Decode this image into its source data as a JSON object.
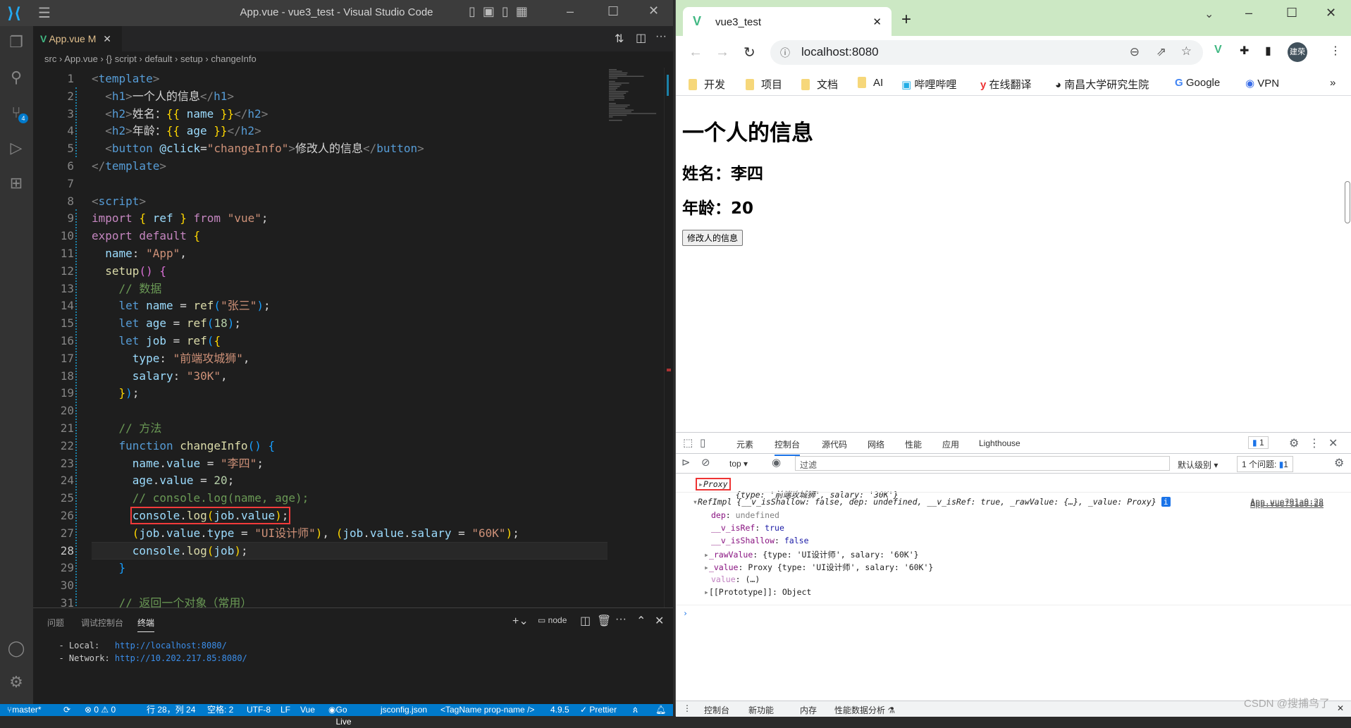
{
  "vscode": {
    "title": "App.vue - vue3_test - Visual Studio Code",
    "tab": {
      "label": "App.vue",
      "modified": "M"
    },
    "breadcrumb": [
      "src",
      "App.vue",
      "{} script",
      "default",
      "setup",
      "changeInfo"
    ],
    "source_control_badge": "4",
    "current_line": 28,
    "code": [
      [
        [
          "p",
          "<"
        ],
        [
          "tag",
          "template"
        ],
        [
          "p",
          ">"
        ]
      ],
      [
        [
          "t",
          "  "
        ],
        [
          "p",
          "<"
        ],
        [
          "tag",
          "h1"
        ],
        [
          "p",
          ">"
        ],
        [
          "t",
          "一个人的信息"
        ],
        [
          "p",
          "</"
        ],
        [
          "tag",
          "h1"
        ],
        [
          "p",
          ">"
        ]
      ],
      [
        [
          "t",
          "  "
        ],
        [
          "p",
          "<"
        ],
        [
          "tag",
          "h2"
        ],
        [
          "p",
          ">"
        ],
        [
          "t",
          "姓名："
        ],
        [
          "br1",
          "{{"
        ],
        [
          "var",
          " name "
        ],
        [
          "br1",
          "}}"
        ],
        [
          "p",
          "</"
        ],
        [
          "tag",
          "h2"
        ],
        [
          "p",
          ">"
        ]
      ],
      [
        [
          "t",
          "  "
        ],
        [
          "p",
          "<"
        ],
        [
          "tag",
          "h2"
        ],
        [
          "p",
          ">"
        ],
        [
          "t",
          "年龄："
        ],
        [
          "br1",
          "{{"
        ],
        [
          "var",
          " age "
        ],
        [
          "br1",
          "}}"
        ],
        [
          "p",
          "</"
        ],
        [
          "tag",
          "h2"
        ],
        [
          "p",
          ">"
        ]
      ],
      [
        [
          "t",
          "  "
        ],
        [
          "p",
          "<"
        ],
        [
          "tag",
          "button"
        ],
        [
          "t",
          " "
        ],
        [
          "var",
          "@click"
        ],
        [
          "t",
          "="
        ],
        [
          "str",
          "\"changeInfo\""
        ],
        [
          "p",
          ">"
        ],
        [
          "t",
          "修改人的信息"
        ],
        [
          "p",
          "</"
        ],
        [
          "tag",
          "button"
        ],
        [
          "p",
          ">"
        ]
      ],
      [
        [
          "p",
          "</"
        ],
        [
          "tag",
          "template"
        ],
        [
          "p",
          ">"
        ]
      ],
      [],
      [
        [
          "p",
          "<"
        ],
        [
          "tag",
          "script"
        ],
        [
          "p",
          ">"
        ]
      ],
      [
        [
          "kw",
          "import"
        ],
        [
          "t",
          " "
        ],
        [
          "br1",
          "{"
        ],
        [
          "var",
          " ref "
        ],
        [
          "br1",
          "}"
        ],
        [
          "t",
          " "
        ],
        [
          "kw",
          "from"
        ],
        [
          "t",
          " "
        ],
        [
          "str",
          "\"vue\""
        ],
        [
          "t",
          ";"
        ]
      ],
      [
        [
          "kw",
          "export default"
        ],
        [
          "t",
          " "
        ],
        [
          "br1",
          "{"
        ]
      ],
      [
        [
          "t",
          "  "
        ],
        [
          "var",
          "name"
        ],
        [
          "t",
          ": "
        ],
        [
          "str",
          "\"App\""
        ],
        [
          "t",
          ","
        ]
      ],
      [
        [
          "t",
          "  "
        ],
        [
          "fn",
          "setup"
        ],
        [
          "br2",
          "()"
        ],
        [
          "t",
          " "
        ],
        [
          "br2",
          "{"
        ]
      ],
      [
        [
          "t",
          "    "
        ],
        [
          "cm",
          "// 数据"
        ]
      ],
      [
        [
          "t",
          "    "
        ],
        [
          "kw2",
          "let"
        ],
        [
          "t",
          " "
        ],
        [
          "var",
          "name"
        ],
        [
          "t",
          " = "
        ],
        [
          "fn",
          "ref"
        ],
        [
          "br3",
          "("
        ],
        [
          "str",
          "\"张三\""
        ],
        [
          "br3",
          ")"
        ],
        [
          "t",
          ";"
        ]
      ],
      [
        [
          "t",
          "    "
        ],
        [
          "kw2",
          "let"
        ],
        [
          "t",
          " "
        ],
        [
          "var",
          "age"
        ],
        [
          "t",
          " = "
        ],
        [
          "fn",
          "ref"
        ],
        [
          "br3",
          "("
        ],
        [
          "num",
          "18"
        ],
        [
          "br3",
          ")"
        ],
        [
          "t",
          ";"
        ]
      ],
      [
        [
          "t",
          "    "
        ],
        [
          "kw2",
          "let"
        ],
        [
          "t",
          " "
        ],
        [
          "var",
          "job"
        ],
        [
          "t",
          " = "
        ],
        [
          "fn",
          "ref"
        ],
        [
          "br3",
          "("
        ],
        [
          "br1",
          "{"
        ]
      ],
      [
        [
          "t",
          "      "
        ],
        [
          "var",
          "type"
        ],
        [
          "t",
          ": "
        ],
        [
          "str",
          "\"前端攻城狮\""
        ],
        [
          "t",
          ","
        ]
      ],
      [
        [
          "t",
          "      "
        ],
        [
          "var",
          "salary"
        ],
        [
          "t",
          ": "
        ],
        [
          "str",
          "\"30K\""
        ],
        [
          "t",
          ","
        ]
      ],
      [
        [
          "t",
          "    "
        ],
        [
          "br1",
          "}"
        ],
        [
          "br3",
          ")"
        ],
        [
          "t",
          ";"
        ]
      ],
      [],
      [
        [
          "t",
          "    "
        ],
        [
          "cm",
          "// 方法"
        ]
      ],
      [
        [
          "t",
          "    "
        ],
        [
          "kw2",
          "function"
        ],
        [
          "t",
          " "
        ],
        [
          "fn",
          "changeInfo"
        ],
        [
          "br3",
          "()"
        ],
        [
          "t",
          " "
        ],
        [
          "br3",
          "{"
        ]
      ],
      [
        [
          "t",
          "      "
        ],
        [
          "var",
          "name"
        ],
        [
          "t",
          "."
        ],
        [
          "var",
          "value"
        ],
        [
          "t",
          " = "
        ],
        [
          "str",
          "\"李四\""
        ],
        [
          "t",
          ";"
        ]
      ],
      [
        [
          "t",
          "      "
        ],
        [
          "var",
          "age"
        ],
        [
          "t",
          "."
        ],
        [
          "var",
          "value"
        ],
        [
          "t",
          " = "
        ],
        [
          "num",
          "20"
        ],
        [
          "t",
          ";"
        ]
      ],
      [
        [
          "t",
          "      "
        ],
        [
          "cm",
          "// console.log(name, age);"
        ]
      ],
      [
        [
          "t",
          "      "
        ],
        [
          "var",
          "console"
        ],
        [
          "t",
          "."
        ],
        [
          "fn",
          "log"
        ],
        [
          "br1",
          "("
        ],
        [
          "var",
          "job"
        ],
        [
          "t",
          "."
        ],
        [
          "var",
          "value"
        ],
        [
          "br1",
          ")"
        ],
        [
          "t",
          ";"
        ]
      ],
      [
        [
          "t",
          "      "
        ],
        [
          "br1",
          "("
        ],
        [
          "var",
          "job"
        ],
        [
          "t",
          "."
        ],
        [
          "var",
          "value"
        ],
        [
          "t",
          "."
        ],
        [
          "var",
          "type"
        ],
        [
          "t",
          " = "
        ],
        [
          "str",
          "\"UI设计师\""
        ],
        [
          "br1",
          ")"
        ],
        [
          "t",
          ", "
        ],
        [
          "br1",
          "("
        ],
        [
          "var",
          "job"
        ],
        [
          "t",
          "."
        ],
        [
          "var",
          "value"
        ],
        [
          "t",
          "."
        ],
        [
          "var",
          "salary"
        ],
        [
          "t",
          " = "
        ],
        [
          "str",
          "\"60K\""
        ],
        [
          "br1",
          ")"
        ],
        [
          "t",
          ";"
        ]
      ],
      [
        [
          "t",
          "      "
        ],
        [
          "var",
          "console"
        ],
        [
          "t",
          "."
        ],
        [
          "fn",
          "log"
        ],
        [
          "br1",
          "("
        ],
        [
          "var",
          "job"
        ],
        [
          "br1",
          ")"
        ],
        [
          "t",
          ";"
        ]
      ],
      [
        [
          "t",
          "    "
        ],
        [
          "br3",
          "}"
        ]
      ],
      [],
      [
        [
          "t",
          "    "
        ],
        [
          "cm",
          "// 返回一个对象（常用）"
        ]
      ]
    ],
    "panel": {
      "tabs": [
        "问题",
        "调试控制台",
        "终端"
      ],
      "active_tab": "终端",
      "shell": "node",
      "terminal": [
        {
          "label": "  - Local:   ",
          "url": "http://localhost:8080/"
        },
        {
          "label": "  - Network: ",
          "url": "http://10.202.217.85:8080/"
        }
      ]
    },
    "status": {
      "branch": "master*",
      "problems": "⊗ 0 ⚠ 0",
      "position": "行 28，列 24",
      "spaces": "空格: 2",
      "encoding": "UTF-8",
      "eol": "LF",
      "language": "Vue",
      "golive": "Go Live",
      "config": "jsconfig.json",
      "tagname": "<TagName prop-name />",
      "version": "4.9.5",
      "prettier": "✓ Prettier"
    },
    "accent": "#007acc"
  },
  "browser": {
    "tab_title": "vue3_test",
    "url": "localhost:8080",
    "profile": "建荣",
    "bookmarks": [
      "开发",
      "项目",
      "文档",
      "AI",
      "哔哩哔哩",
      "在线翻译",
      "南昌大学研究生院",
      "Google",
      "VPN"
    ],
    "page": {
      "h1": "一个人的信息",
      "name_line": "姓名：李四",
      "age_line": "年龄：20",
      "button": "修改人的信息"
    },
    "devtools": {
      "tabs": [
        "元素",
        "控制台",
        "源代码",
        "网络",
        "性能",
        "应用",
        "Lighthouse"
      ],
      "active_tab": "控制台",
      "issues_badge": "1",
      "context": "top",
      "filter_placeholder": "过滤",
      "level": "默认级别",
      "issues": "1 个问题:",
      "issues_count": "1",
      "log1": {
        "prefix": "Proxy",
        "body": " {type: '前端攻城狮', salary: '30K'}",
        "source": "App.vue?91a0:26"
      },
      "log2": {
        "summary": "RefImpl {__v_isShallow: false, dep: undefined, __v_isRef: true, _rawValue: {…}, _value: Proxy}",
        "source": "App.vue?91a0:28",
        "props": [
          {
            "key": "dep",
            "value": "undefined"
          },
          {
            "key": "__v_isRef",
            "value": "true"
          },
          {
            "key": "__v_isShallow",
            "value": "false"
          },
          {
            "key": "_rawValue",
            "value": "{type: 'UI设计师', salary: '60K'}"
          },
          {
            "key": "_value",
            "value": "Proxy {type: 'UI设计师', salary: '60K'}"
          },
          {
            "key": "value",
            "value": "(…)"
          },
          {
            "key": "[[Prototype]]",
            "value": "Object"
          }
        ]
      },
      "drawer_tabs": [
        "控制台",
        "新功能",
        "内存",
        "性能数据分析"
      ]
    },
    "watermark": "CSDN @搜捕鸟了"
  }
}
